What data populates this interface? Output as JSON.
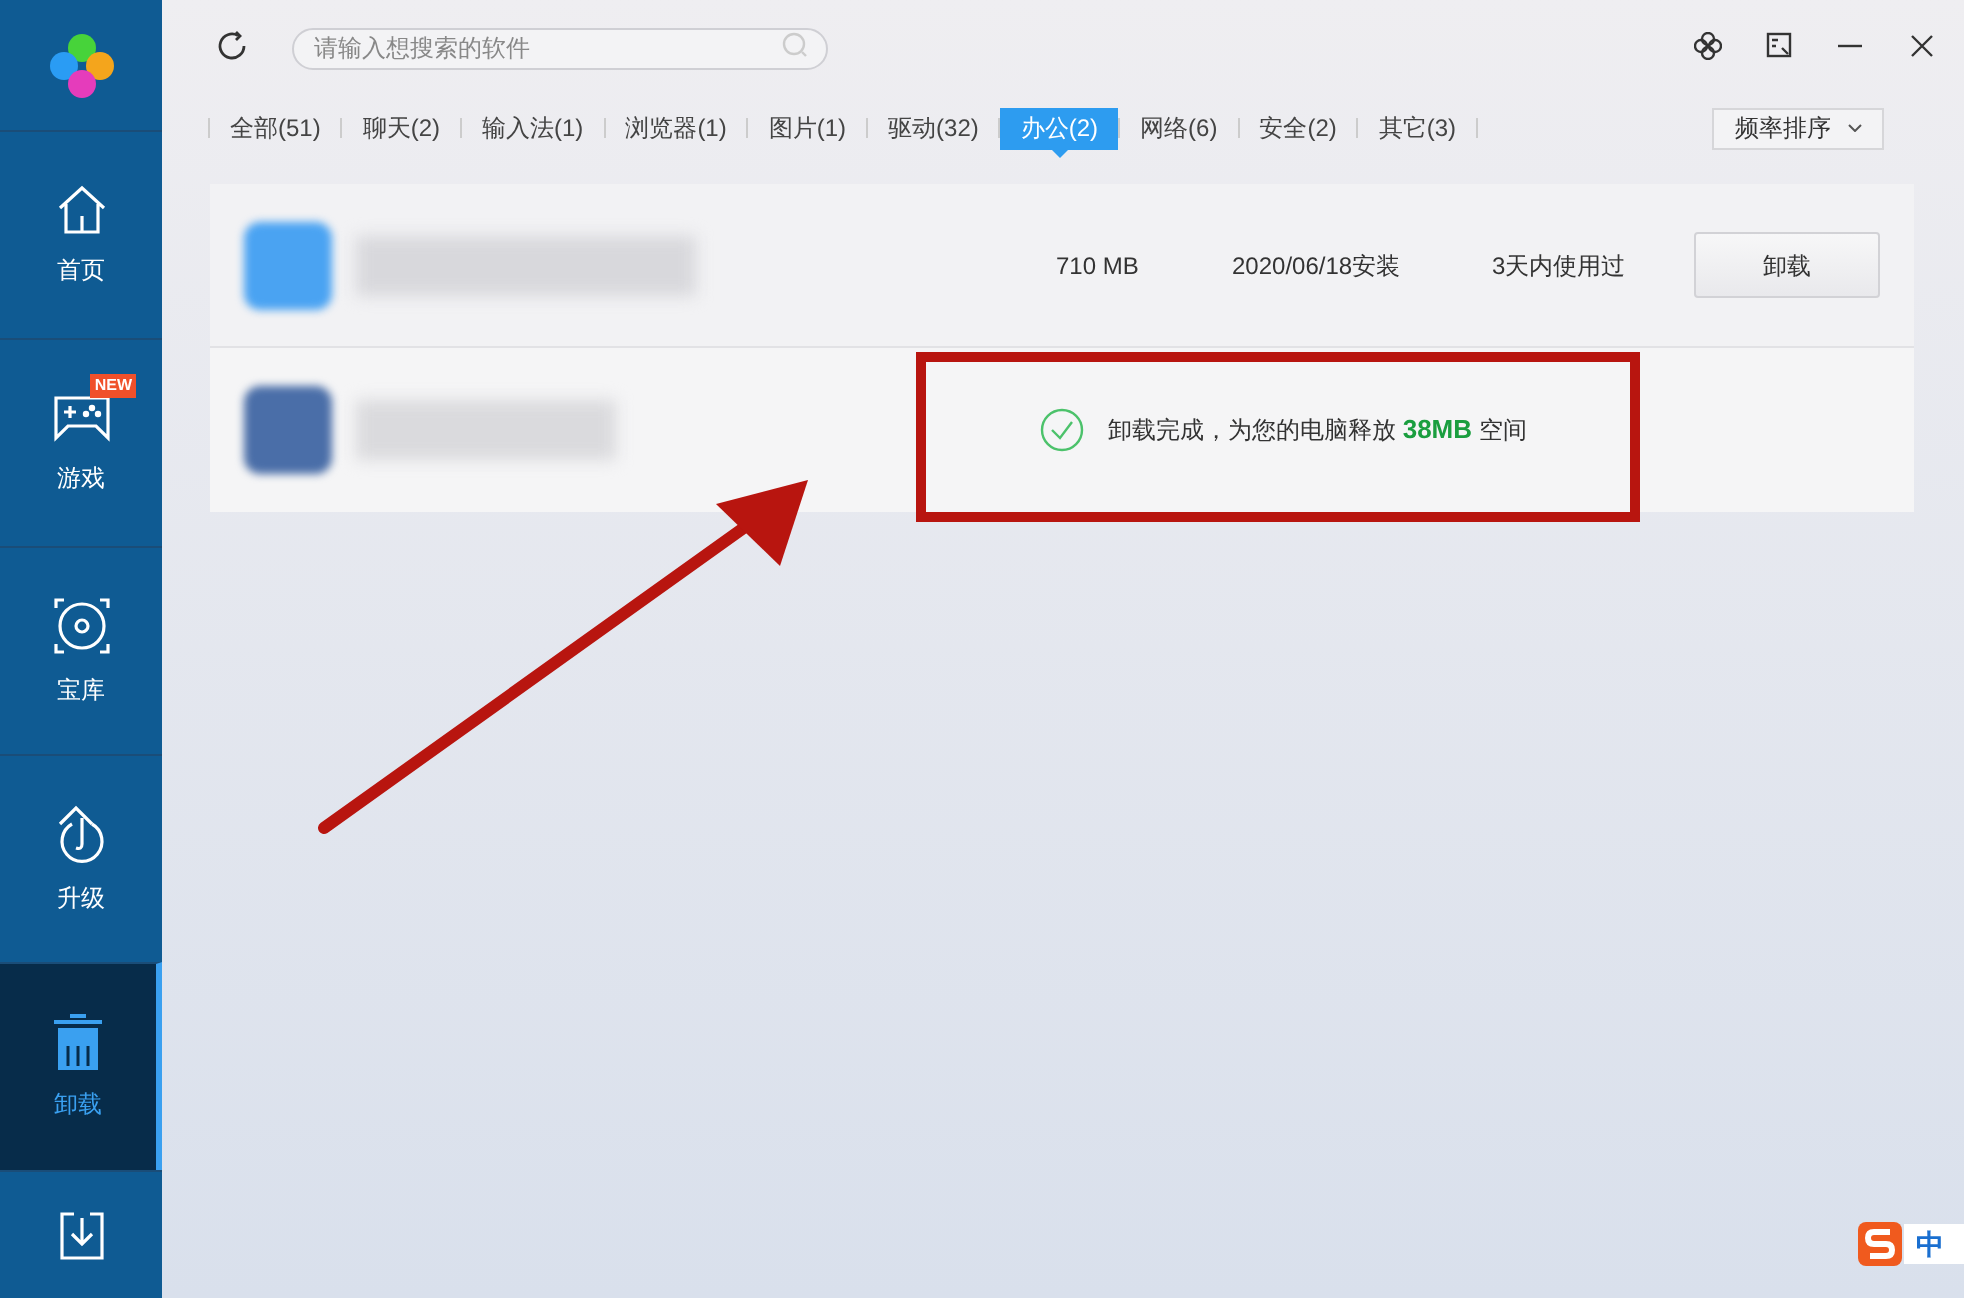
{
  "search": {
    "placeholder": "请输入想搜索的软件"
  },
  "sidebar": [
    {
      "kind": "home",
      "label": "首页",
      "selected": false
    },
    {
      "kind": "game",
      "label": "游戏",
      "selected": false,
      "badge": "NEW"
    },
    {
      "kind": "disc",
      "label": "宝库",
      "selected": false
    },
    {
      "kind": "upgrade",
      "label": "升级",
      "selected": false
    },
    {
      "kind": "trash",
      "label": "卸载",
      "selected": true
    },
    {
      "kind": "download",
      "selected": false
    }
  ],
  "tabs": [
    {
      "label": "全部(51)",
      "selected": false
    },
    {
      "label": "聊天(2)",
      "selected": false
    },
    {
      "label": "输入法(1)",
      "selected": false
    },
    {
      "label": "浏览器(1)",
      "selected": false
    },
    {
      "label": "图片(1)",
      "selected": false
    },
    {
      "label": "驱动(32)",
      "selected": false
    },
    {
      "label": "办公(2)",
      "selected": true
    },
    {
      "label": "网络(6)",
      "selected": false
    },
    {
      "label": "安全(2)",
      "selected": false
    },
    {
      "label": "其它(3)",
      "selected": false
    }
  ],
  "sort": {
    "label": "频率排序"
  },
  "apps": [
    {
      "kind": "installed",
      "size": "710 MB",
      "date": "2020/06/18安装",
      "last_used": "3天内使用过",
      "button": "卸载"
    },
    {
      "kind": "uninstalled",
      "message": "卸载完成，为您的电脑释放",
      "freed": "38MB",
      "message_end": "空间"
    }
  ],
  "ime": {
    "label": "中"
  }
}
